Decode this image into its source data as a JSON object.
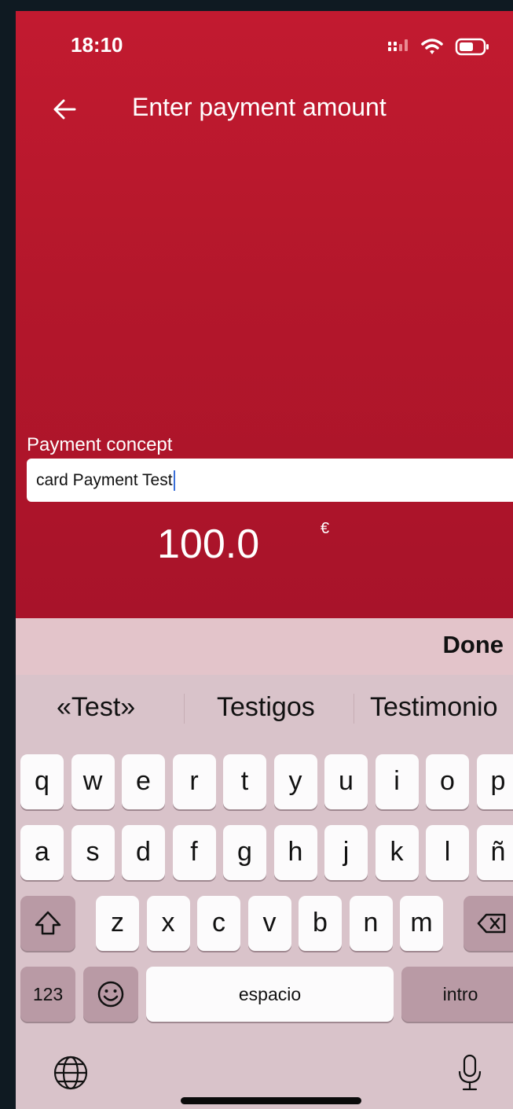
{
  "status_bar": {
    "time": "18:10"
  },
  "header": {
    "title": "Enter payment amount"
  },
  "form": {
    "concept_label": "Payment concept",
    "concept_value": "card Payment Test",
    "amount": "100.0",
    "currency": "€"
  },
  "accessory": {
    "done_label": "Done"
  },
  "keyboard": {
    "suggestions": [
      "«Test»",
      "Testigos",
      "Testimonio"
    ],
    "row1": [
      "q",
      "w",
      "e",
      "r",
      "t",
      "y",
      "u",
      "i",
      "o",
      "p"
    ],
    "row2": [
      "a",
      "s",
      "d",
      "f",
      "g",
      "h",
      "j",
      "k",
      "l",
      "ñ"
    ],
    "row3": [
      "z",
      "x",
      "c",
      "v",
      "b",
      "n",
      "m"
    ],
    "numbers_label": "123",
    "space_label": "espacio",
    "return_label": "intro"
  },
  "colors": {
    "header_red": "#c21a30",
    "keyboard_bg": "#d9c3ca",
    "caret_blue": "#3a6fd8"
  }
}
